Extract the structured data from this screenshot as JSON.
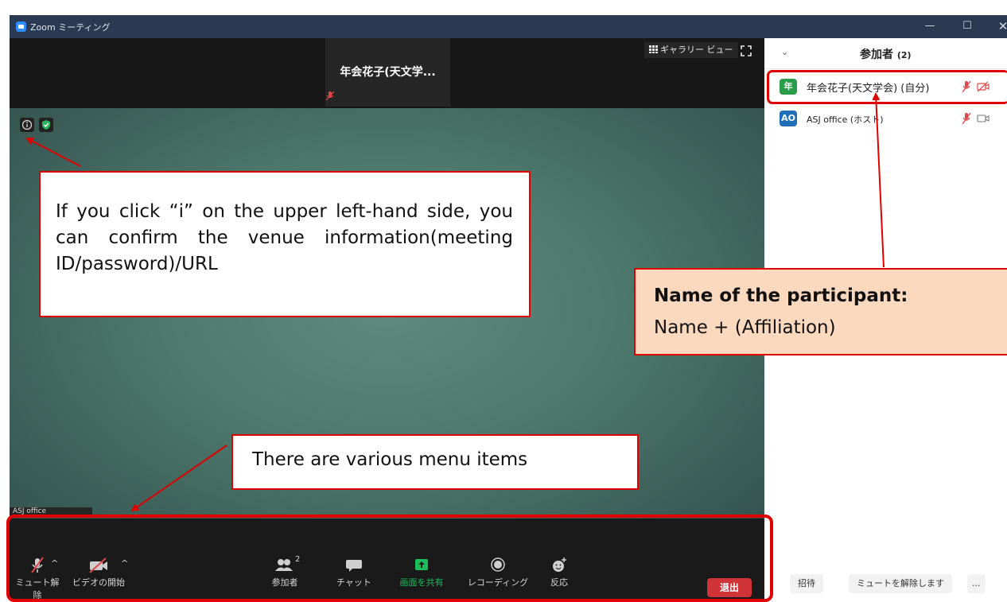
{
  "window": {
    "title": "Zoom ミーティング",
    "minimize": "—",
    "maximize": "☐",
    "close": "✕"
  },
  "stage": {
    "thumbnail_name": "年会花子(天文学...",
    "gallery_view_label": "ギャラリー ビュー",
    "name_tag": "ASJ office"
  },
  "toolbar": {
    "unmute": "ミュート解除",
    "start_video": "ビデオの開始",
    "participants": "参加者",
    "participants_count": "2",
    "chat": "チャット",
    "share_screen": "画面を共有",
    "recording": "レコーディング",
    "reactions": "反応",
    "leave": "退出"
  },
  "participants_panel": {
    "title": "参加者",
    "count": "(2)",
    "participants": [
      {
        "avatar": "年",
        "name": "年会花子(天文学会) (自分)",
        "avatar_color": "#2a9d4a"
      },
      {
        "avatar": "AO",
        "name": "ASJ office (ホスト)",
        "avatar_color": "#1f6fb8"
      }
    ],
    "invite": "招待",
    "unmute_all": "ミュートを解除します",
    "more": "..."
  },
  "annotations": {
    "info_note": "If you click “i” on the upper left-hand side, you can confirm the venue information(meeting ID/password)/URL",
    "menu_note": "There are various menu items",
    "participant_note_heading": "Name of the participant:",
    "participant_note_body": "Name + (Affiliation)"
  },
  "colors": {
    "accent_red": "#e00000",
    "share_green": "#1bbc5c",
    "leave_red": "#d13438",
    "note_fill": "#fbd9bf"
  }
}
